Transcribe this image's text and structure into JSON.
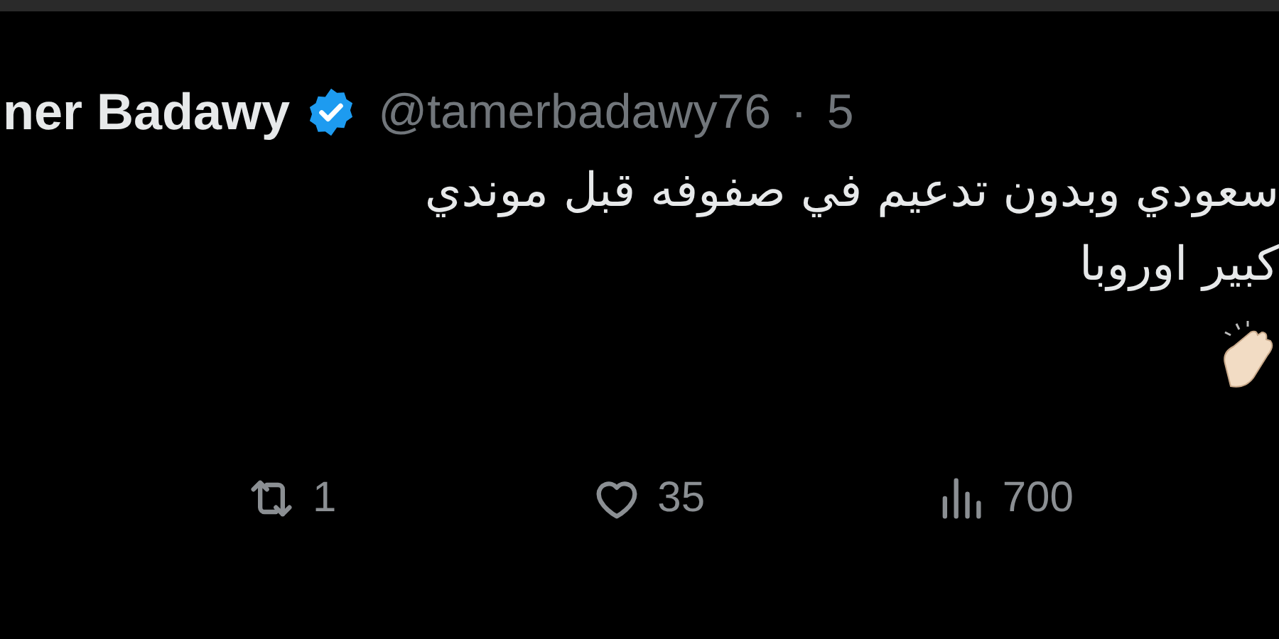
{
  "author": {
    "name": "ner Badawy",
    "verified": true,
    "handle": "@tamerbadawy76",
    "separator": "·",
    "time": "5"
  },
  "text_lines": [
    "سعودي وبدون تدعيم في صفوفه قبل موندي",
    "كبير اوروبا"
  ],
  "retweets": {
    "kind": "retweet",
    "count": "1"
  },
  "likes": {
    "kind": "like",
    "count": "35"
  },
  "views": {
    "kind": "views",
    "count": "700"
  }
}
